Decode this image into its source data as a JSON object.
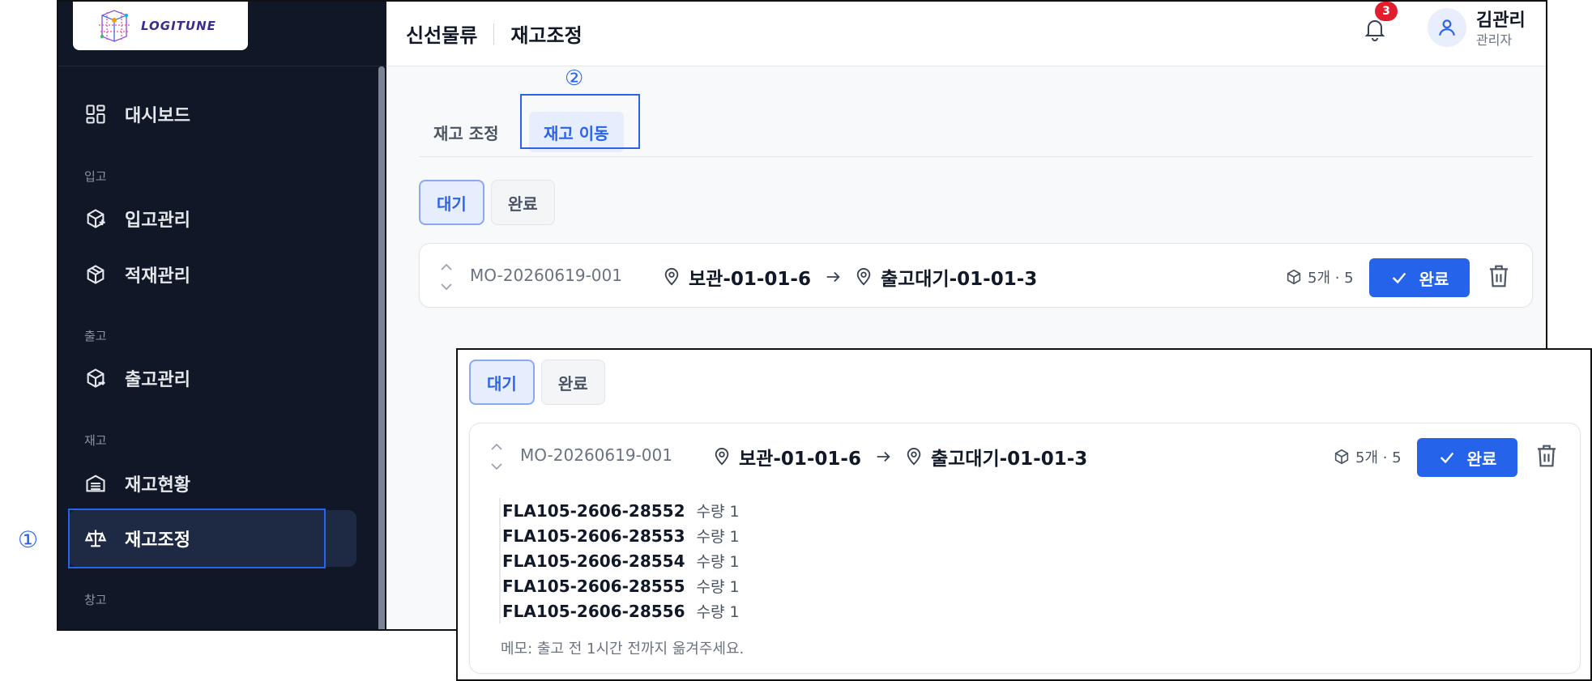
{
  "logo": {
    "text": "LOGITUNE"
  },
  "sidebar": {
    "dashboard": "대시보드",
    "sections": {
      "inbound": "입고",
      "outbound": "출고",
      "inventory": "재고",
      "warehouse": "창고"
    },
    "items": {
      "inbound_mgmt": "입고관리",
      "stacking_mgmt": "적재관리",
      "outbound_mgmt": "출고관리",
      "inventory_status": "재고현황",
      "inventory_adjust": "재고조정"
    },
    "active": "재고조정"
  },
  "header": {
    "breadcrumb_1": "신선물류",
    "breadcrumb_2": "재고조정",
    "notification_count": "3",
    "user_name": "김관리",
    "user_role": "관리자"
  },
  "annotations": {
    "marker_1": "①",
    "marker_2": "②"
  },
  "tabs": {
    "adjust": "재고 조정",
    "move": "재고 이동",
    "active": "재고 이동"
  },
  "filters": {
    "pending": "대기",
    "done": "완료",
    "active": "대기"
  },
  "move_order": {
    "code": "MO-20260619-001",
    "from": "보관-01-01-6",
    "to": "출고대기-01-01-3",
    "qty": "5개 · 5",
    "complete_button": "완료",
    "details": [
      {
        "lot": "FLA105-2606-28552",
        "qty": "수량 1"
      },
      {
        "lot": "FLA105-2606-28553",
        "qty": "수량 1"
      },
      {
        "lot": "FLA105-2606-28554",
        "qty": "수량 1"
      },
      {
        "lot": "FLA105-2606-28555",
        "qty": "수량 1"
      },
      {
        "lot": "FLA105-2606-28556",
        "qty": "수량 1"
      }
    ],
    "memo": "메모: 출고 전 1시간 전까지 옮겨주세요."
  },
  "colors": {
    "sidebar_bg": "#101828",
    "accent": "#2563eb",
    "highlight_outline": "#2b63e8",
    "badge": "#e11d2e"
  },
  "icons": {
    "dashboard": "grid-icon",
    "inbound": "box-plus-icon",
    "stacking": "box-icon",
    "outbound": "box-out-icon",
    "inventory_status": "warehouse-icon",
    "inventory_adjust": "scale-icon",
    "notification": "bell-icon",
    "user": "user-icon",
    "location": "map-pin-icon",
    "package": "package-icon",
    "check": "check-icon",
    "delete": "trash-icon",
    "expand": "chevron-updown-icon"
  }
}
